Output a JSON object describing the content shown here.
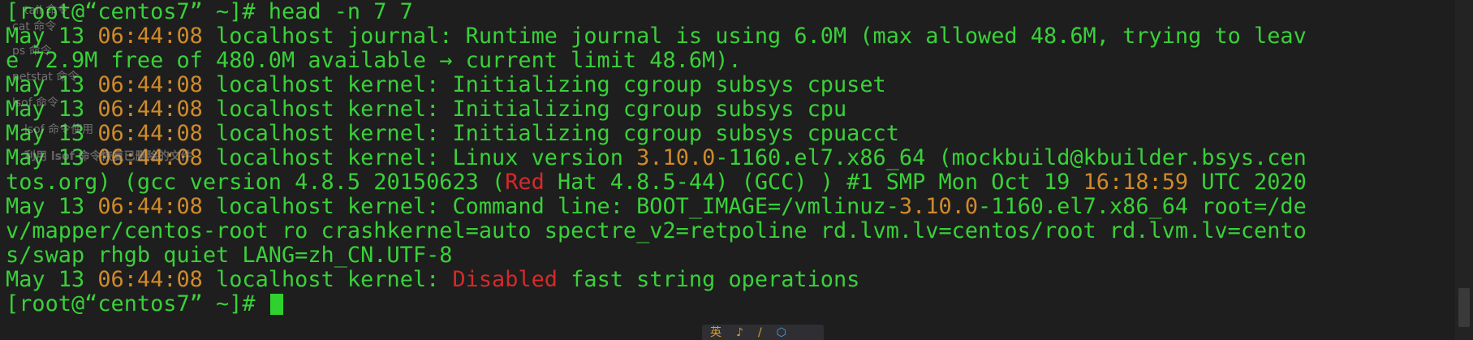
{
  "terminal": {
    "lines": [
      [
        {
          "t": "[root@“centos7” ~]# head -n 7 7",
          "c": "g"
        }
      ],
      [
        {
          "t": "May 13 ",
          "c": "g"
        },
        {
          "t": "06:44:08",
          "c": "o"
        },
        {
          "t": " localhost journal: Runtime journal is using 6.0M (max allowed 48.6M, trying to leav",
          "c": "g"
        }
      ],
      [
        {
          "t": "e 72.9M free of 480.0M available → current limit 48.6M).",
          "c": "g"
        }
      ],
      [
        {
          "t": "May 13 ",
          "c": "g"
        },
        {
          "t": "06:44:08",
          "c": "o"
        },
        {
          "t": " localhost kernel: Initializing cgroup subsys cpuset",
          "c": "g"
        }
      ],
      [
        {
          "t": "May 13 ",
          "c": "g"
        },
        {
          "t": "06:44:08",
          "c": "o"
        },
        {
          "t": " localhost kernel: Initializing cgroup subsys cpu",
          "c": "g"
        }
      ],
      [
        {
          "t": "May 13 ",
          "c": "g"
        },
        {
          "t": "06:44:08",
          "c": "o"
        },
        {
          "t": " localhost kernel: Initializing cgroup subsys cpuacct",
          "c": "g"
        }
      ],
      [
        {
          "t": "May 13 ",
          "c": "g"
        },
        {
          "t": "06:44:08",
          "c": "o"
        },
        {
          "t": " localhost kernel: Linux version ",
          "c": "g"
        },
        {
          "t": "3.10.0",
          "c": "o"
        },
        {
          "t": "-1160.el7.x86_64 (mockbuild@kbuilder.bsys.cen",
          "c": "g"
        }
      ],
      [
        {
          "t": "tos.org) (gcc version 4.8.5 20150623 (",
          "c": "g"
        },
        {
          "t": "Red",
          "c": "r"
        },
        {
          "t": " Hat 4.8.5-44) (GCC) ) #1 SMP Mon Oct 19 ",
          "c": "g"
        },
        {
          "t": "16:18:59",
          "c": "o"
        },
        {
          "t": " UTC 2020",
          "c": "g"
        }
      ],
      [
        {
          "t": "May 13 ",
          "c": "g"
        },
        {
          "t": "06:44:08",
          "c": "o"
        },
        {
          "t": " localhost kernel: Command line: BOOT_IMAGE=/vmlinuz-",
          "c": "g"
        },
        {
          "t": "3.10.0",
          "c": "o"
        },
        {
          "t": "-1160.el7.x86_64 root=/de",
          "c": "g"
        }
      ],
      [
        {
          "t": "v/mapper/centos-root ro crashkernel=auto spectre_v2=retpoline rd.lvm.lv=centos/root rd.lvm.lv=cento",
          "c": "g"
        }
      ],
      [
        {
          "t": "s/swap rhgb quiet LANG=zh_CN.UTF-8",
          "c": "g"
        }
      ],
      [
        {
          "t": "May 13 ",
          "c": "g"
        },
        {
          "t": "06:44:08",
          "c": "o"
        },
        {
          "t": " localhost kernel: ",
          "c": "g"
        },
        {
          "t": "Disabled",
          "c": "r"
        },
        {
          "t": " fast string operations",
          "c": "g"
        }
      ],
      [
        {
          "t": "[root@“centos7” ~]# ",
          "c": "g"
        }
      ]
    ]
  },
  "overlay": {
    "items": [
      "tail 命令",
      "cat 命令",
      "ps 命令",
      "netstat 命令",
      "lsof 命令",
      "lsof 命令使用",
      "利用 lsof 命令恢复已删除的文件"
    ]
  },
  "toolbar": {
    "icons": [
      "英",
      "♪",
      "/",
      "⬡"
    ]
  },
  "colors": {
    "background": "#1e1e1e",
    "text_green": "#39d139",
    "text_orange": "#d08a2a",
    "text_red": "#d42a2a"
  }
}
